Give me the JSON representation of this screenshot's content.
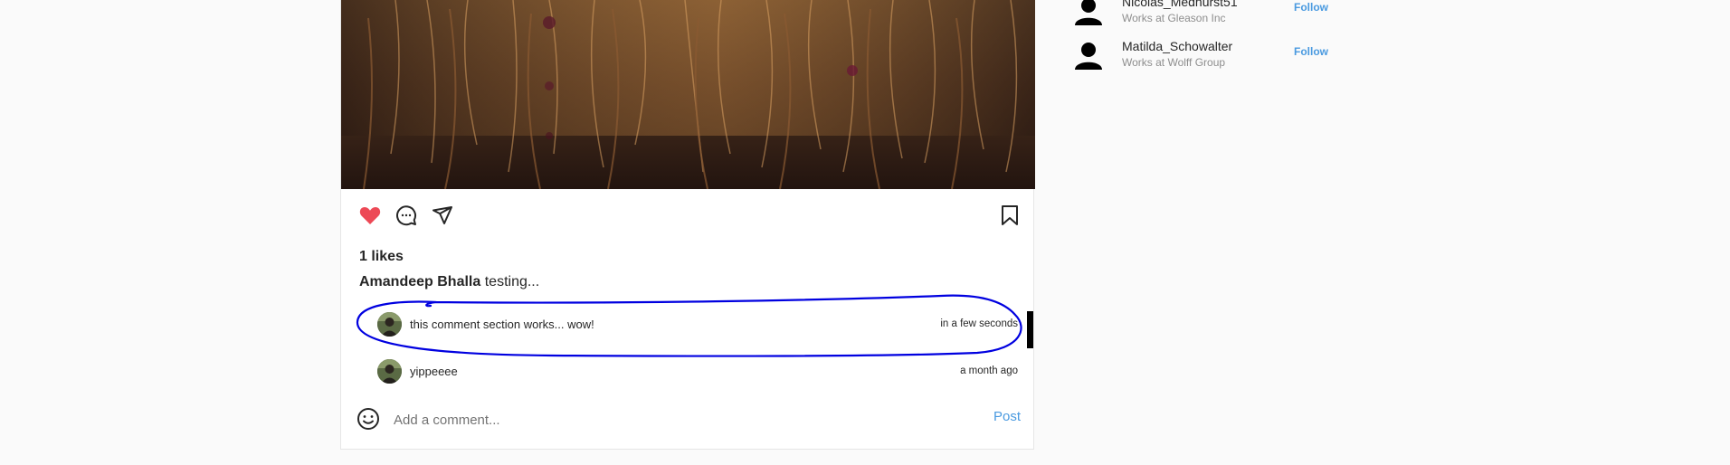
{
  "post": {
    "likes": "1 likes",
    "caption_author": "Amandeep Bhalla",
    "caption_text": "testing...",
    "liked": true,
    "comments": [
      {
        "text": "this comment section works... wow!",
        "time": "in a few seconds"
      },
      {
        "text": "yippeeee",
        "time": "a month ago"
      }
    ],
    "add_comment_placeholder": "Add a comment...",
    "post_button": "Post"
  },
  "suggestions": [
    {
      "name": "Nicolas_Medhurst51",
      "subtitle": "Works at Gleason Inc",
      "follow": "Follow"
    },
    {
      "name": "Matilda_Schowalter",
      "subtitle": "Works at Wolff Group",
      "follow": "Follow"
    }
  ],
  "colors": {
    "like_red": "#ed4956",
    "link_blue": "#4a9ae0",
    "annotation_blue": "#0000e0"
  },
  "icons": {
    "like": "heart-icon",
    "comment": "comment-icon",
    "share": "paper-plane-icon",
    "save": "bookmark-icon",
    "emoji": "smiley-icon"
  }
}
